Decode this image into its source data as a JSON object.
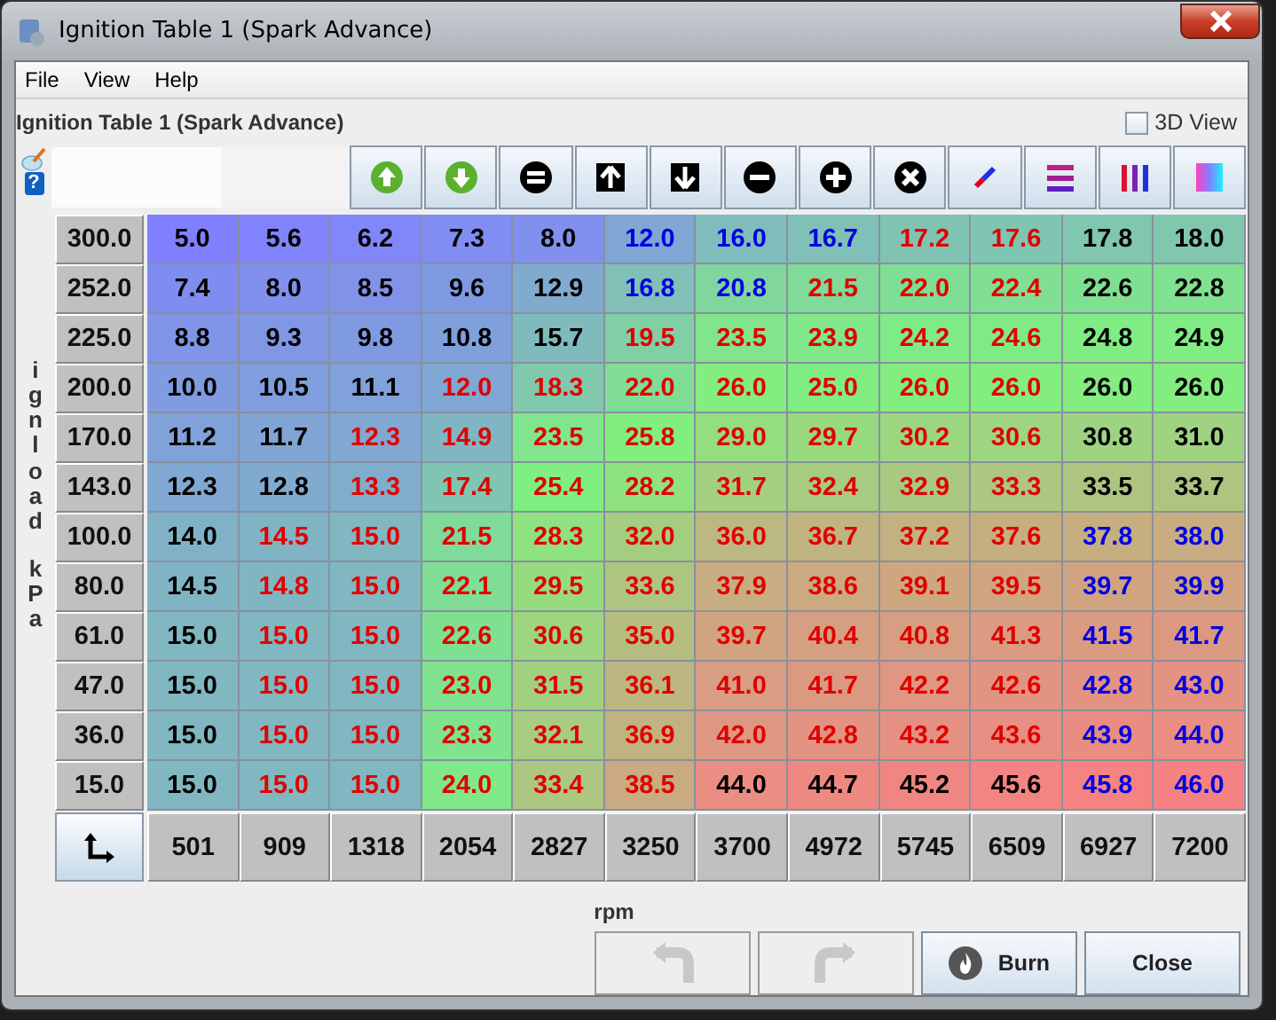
{
  "window": {
    "title": "Ignition Table 1 (Spark Advance)"
  },
  "menu": [
    {
      "label": "File"
    },
    {
      "label": "View"
    },
    {
      "label": "Help"
    }
  ],
  "table_title": "Ignition Table 1 (Spark Advance)",
  "view_3d": {
    "label": "3D View",
    "checked": false
  },
  "help_icon": "?",
  "y_axis": {
    "label": "ignload",
    "unit": "kPa"
  },
  "x_axis": {
    "label": "rpm",
    "values": [
      "501",
      "909",
      "1318",
      "2054",
      "2827",
      "3250",
      "3700",
      "4972",
      "5745",
      "6509",
      "6927",
      "7200"
    ]
  },
  "rows": [
    {
      "load": "300.0",
      "cells": [
        {
          "value": "5.0",
          "color": "#000000"
        },
        {
          "value": "5.6",
          "color": "#000000"
        },
        {
          "value": "6.2",
          "color": "#000000"
        },
        {
          "value": "7.3",
          "color": "#000000"
        },
        {
          "value": "8.0",
          "color": "#000000"
        },
        {
          "value": "12.0",
          "color": "#0000e0"
        },
        {
          "value": "16.0",
          "color": "#0000e0"
        },
        {
          "value": "16.7",
          "color": "#0000e0"
        },
        {
          "value": "17.2",
          "color": "#e00000"
        },
        {
          "value": "17.6",
          "color": "#e00000"
        },
        {
          "value": "17.8",
          "color": "#000000"
        },
        {
          "value": "18.0",
          "color": "#000000"
        }
      ]
    },
    {
      "load": "252.0",
      "cells": [
        {
          "value": "7.4",
          "color": "#000000"
        },
        {
          "value": "8.0",
          "color": "#000000"
        },
        {
          "value": "8.5",
          "color": "#000000"
        },
        {
          "value": "9.6",
          "color": "#000000"
        },
        {
          "value": "12.9",
          "color": "#000000"
        },
        {
          "value": "16.8",
          "color": "#0000e0"
        },
        {
          "value": "20.8",
          "color": "#0000e0"
        },
        {
          "value": "21.5",
          "color": "#e00000"
        },
        {
          "value": "22.0",
          "color": "#e00000"
        },
        {
          "value": "22.4",
          "color": "#e00000"
        },
        {
          "value": "22.6",
          "color": "#000000"
        },
        {
          "value": "22.8",
          "color": "#000000"
        }
      ]
    },
    {
      "load": "225.0",
      "cells": [
        {
          "value": "8.8",
          "color": "#000000"
        },
        {
          "value": "9.3",
          "color": "#000000"
        },
        {
          "value": "9.8",
          "color": "#000000"
        },
        {
          "value": "10.8",
          "color": "#000000"
        },
        {
          "value": "15.7",
          "color": "#000000"
        },
        {
          "value": "19.5",
          "color": "#e00000"
        },
        {
          "value": "23.5",
          "color": "#e00000"
        },
        {
          "value": "23.9",
          "color": "#e00000"
        },
        {
          "value": "24.2",
          "color": "#e00000"
        },
        {
          "value": "24.6",
          "color": "#e00000"
        },
        {
          "value": "24.8",
          "color": "#000000"
        },
        {
          "value": "24.9",
          "color": "#000000"
        }
      ]
    },
    {
      "load": "200.0",
      "cells": [
        {
          "value": "10.0",
          "color": "#000000"
        },
        {
          "value": "10.5",
          "color": "#000000"
        },
        {
          "value": "11.1",
          "color": "#000000"
        },
        {
          "value": "12.0",
          "color": "#e00000"
        },
        {
          "value": "18.3",
          "color": "#e00000"
        },
        {
          "value": "22.0",
          "color": "#e00000"
        },
        {
          "value": "26.0",
          "color": "#e00000"
        },
        {
          "value": "25.0",
          "color": "#e00000"
        },
        {
          "value": "26.0",
          "color": "#e00000"
        },
        {
          "value": "26.0",
          "color": "#e00000"
        },
        {
          "value": "26.0",
          "color": "#000000"
        },
        {
          "value": "26.0",
          "color": "#000000"
        }
      ]
    },
    {
      "load": "170.0",
      "cells": [
        {
          "value": "11.2",
          "color": "#000000"
        },
        {
          "value": "11.7",
          "color": "#000000"
        },
        {
          "value": "12.3",
          "color": "#e00000"
        },
        {
          "value": "14.9",
          "color": "#e00000"
        },
        {
          "value": "23.5",
          "color": "#e00000"
        },
        {
          "value": "25.8",
          "color": "#e00000"
        },
        {
          "value": "29.0",
          "color": "#e00000"
        },
        {
          "value": "29.7",
          "color": "#e00000"
        },
        {
          "value": "30.2",
          "color": "#e00000"
        },
        {
          "value": "30.6",
          "color": "#e00000"
        },
        {
          "value": "30.8",
          "color": "#000000"
        },
        {
          "value": "31.0",
          "color": "#000000"
        }
      ]
    },
    {
      "load": "143.0",
      "cells": [
        {
          "value": "12.3",
          "color": "#000000"
        },
        {
          "value": "12.8",
          "color": "#000000"
        },
        {
          "value": "13.3",
          "color": "#e00000"
        },
        {
          "value": "17.4",
          "color": "#e00000"
        },
        {
          "value": "25.4",
          "color": "#e00000"
        },
        {
          "value": "28.2",
          "color": "#e00000"
        },
        {
          "value": "31.7",
          "color": "#e00000"
        },
        {
          "value": "32.4",
          "color": "#e00000"
        },
        {
          "value": "32.9",
          "color": "#e00000"
        },
        {
          "value": "33.3",
          "color": "#e00000"
        },
        {
          "value": "33.5",
          "color": "#000000"
        },
        {
          "value": "33.7",
          "color": "#000000"
        }
      ]
    },
    {
      "load": "100.0",
      "cells": [
        {
          "value": "14.0",
          "color": "#000000"
        },
        {
          "value": "14.5",
          "color": "#e00000"
        },
        {
          "value": "15.0",
          "color": "#e00000"
        },
        {
          "value": "21.5",
          "color": "#e00000"
        },
        {
          "value": "28.3",
          "color": "#e00000"
        },
        {
          "value": "32.0",
          "color": "#e00000"
        },
        {
          "value": "36.0",
          "color": "#e00000"
        },
        {
          "value": "36.7",
          "color": "#e00000"
        },
        {
          "value": "37.2",
          "color": "#e00000"
        },
        {
          "value": "37.6",
          "color": "#e00000"
        },
        {
          "value": "37.8",
          "color": "#0000e0"
        },
        {
          "value": "38.0",
          "color": "#0000e0"
        }
      ]
    },
    {
      "load": "80.0",
      "cells": [
        {
          "value": "14.5",
          "color": "#000000"
        },
        {
          "value": "14.8",
          "color": "#e00000"
        },
        {
          "value": "15.0",
          "color": "#e00000"
        },
        {
          "value": "22.1",
          "color": "#e00000"
        },
        {
          "value": "29.5",
          "color": "#e00000"
        },
        {
          "value": "33.6",
          "color": "#e00000"
        },
        {
          "value": "37.9",
          "color": "#e00000"
        },
        {
          "value": "38.6",
          "color": "#e00000"
        },
        {
          "value": "39.1",
          "color": "#e00000"
        },
        {
          "value": "39.5",
          "color": "#e00000"
        },
        {
          "value": "39.7",
          "color": "#0000e0"
        },
        {
          "value": "39.9",
          "color": "#0000e0"
        }
      ]
    },
    {
      "load": "61.0",
      "cells": [
        {
          "value": "15.0",
          "color": "#000000"
        },
        {
          "value": "15.0",
          "color": "#e00000"
        },
        {
          "value": "15.0",
          "color": "#e00000"
        },
        {
          "value": "22.6",
          "color": "#e00000"
        },
        {
          "value": "30.6",
          "color": "#e00000"
        },
        {
          "value": "35.0",
          "color": "#e00000"
        },
        {
          "value": "39.7",
          "color": "#e00000"
        },
        {
          "value": "40.4",
          "color": "#e00000"
        },
        {
          "value": "40.8",
          "color": "#e00000"
        },
        {
          "value": "41.3",
          "color": "#e00000"
        },
        {
          "value": "41.5",
          "color": "#0000e0"
        },
        {
          "value": "41.7",
          "color": "#0000e0"
        }
      ]
    },
    {
      "load": "47.0",
      "cells": [
        {
          "value": "15.0",
          "color": "#000000"
        },
        {
          "value": "15.0",
          "color": "#e00000"
        },
        {
          "value": "15.0",
          "color": "#e00000"
        },
        {
          "value": "23.0",
          "color": "#e00000"
        },
        {
          "value": "31.5",
          "color": "#e00000"
        },
        {
          "value": "36.1",
          "color": "#e00000"
        },
        {
          "value": "41.0",
          "color": "#e00000"
        },
        {
          "value": "41.7",
          "color": "#e00000"
        },
        {
          "value": "42.2",
          "color": "#e00000"
        },
        {
          "value": "42.6",
          "color": "#e00000"
        },
        {
          "value": "42.8",
          "color": "#0000e0"
        },
        {
          "value": "43.0",
          "color": "#0000e0"
        }
      ]
    },
    {
      "load": "36.0",
      "cells": [
        {
          "value": "15.0",
          "color": "#000000"
        },
        {
          "value": "15.0",
          "color": "#e00000"
        },
        {
          "value": "15.0",
          "color": "#e00000"
        },
        {
          "value": "23.3",
          "color": "#e00000"
        },
        {
          "value": "32.1",
          "color": "#e00000"
        },
        {
          "value": "36.9",
          "color": "#e00000"
        },
        {
          "value": "42.0",
          "color": "#e00000"
        },
        {
          "value": "42.8",
          "color": "#e00000"
        },
        {
          "value": "43.2",
          "color": "#e00000"
        },
        {
          "value": "43.6",
          "color": "#e00000"
        },
        {
          "value": "43.9",
          "color": "#0000e0"
        },
        {
          "value": "44.0",
          "color": "#0000e0"
        }
      ]
    },
    {
      "load": "15.0",
      "cells": [
        {
          "value": "15.0",
          "color": "#000000"
        },
        {
          "value": "15.0",
          "color": "#e00000"
        },
        {
          "value": "15.0",
          "color": "#e00000"
        },
        {
          "value": "24.0",
          "color": "#e00000"
        },
        {
          "value": "33.4",
          "color": "#e00000"
        },
        {
          "value": "38.5",
          "color": "#e00000"
        },
        {
          "value": "44.0",
          "color": "#000000"
        },
        {
          "value": "44.7",
          "color": "#000000"
        },
        {
          "value": "45.2",
          "color": "#000000"
        },
        {
          "value": "45.6",
          "color": "#000000"
        },
        {
          "value": "45.8",
          "color": "#0000e0"
        },
        {
          "value": "46.0",
          "color": "#0000e0"
        }
      ]
    }
  ],
  "buttons": [
    {
      "kind": "undo",
      "disabled": true
    },
    {
      "kind": "redo",
      "disabled": true
    },
    {
      "kind": "burn",
      "label": "Burn",
      "disabled": false
    },
    {
      "kind": "close",
      "label": "Close",
      "disabled": false
    }
  ]
}
